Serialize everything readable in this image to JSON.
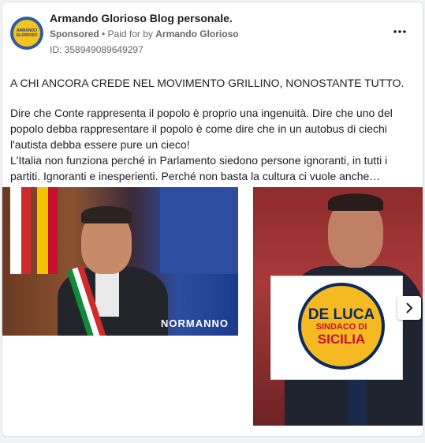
{
  "post": {
    "page_name": "Armando Glorioso Blog personale.",
    "sponsored_label": "Sponsored",
    "paid_for_prefix": " • Paid for by ",
    "paid_for_name": "Armando Glorioso",
    "ad_id": "ID: 358949089649297",
    "more_icon": "more-options-icon",
    "avatar_text": [
      "ARMANDO",
      "GLORIOSO"
    ],
    "text_title": "A CHI ANCORA CREDE NEL MOVIMENTO GRILLINO, NONOSTANTE TUTTO.",
    "text_lines": [
      "Dire che Conte rappresenta il popolo è proprio una ingenuità. Dire che uno del",
      "popolo debba rappresentare il popolo è come dire che in un autobus di ciechi",
      "l'autista debba essere pure un cieco!",
      "L'Italia non funziona perché in Parlamento siedono persone ignoranti, in tutti i",
      "partiti. Ignoranti e inesperienti. Perché non basta la cultura ci vuole anche…"
    ]
  },
  "carousel": {
    "image1_watermark": "NORMANNO",
    "image2_sign": {
      "line1": "DE LUCA",
      "line2": "SINDACO DI",
      "line3": "SICILIA"
    },
    "next_icon": "chevron-right-icon"
  },
  "colors": {
    "secondary_text": "#65676b",
    "sign_yellow": "#f5b921",
    "sign_blue": "#0d2a5c",
    "sign_red": "#c8102e"
  }
}
